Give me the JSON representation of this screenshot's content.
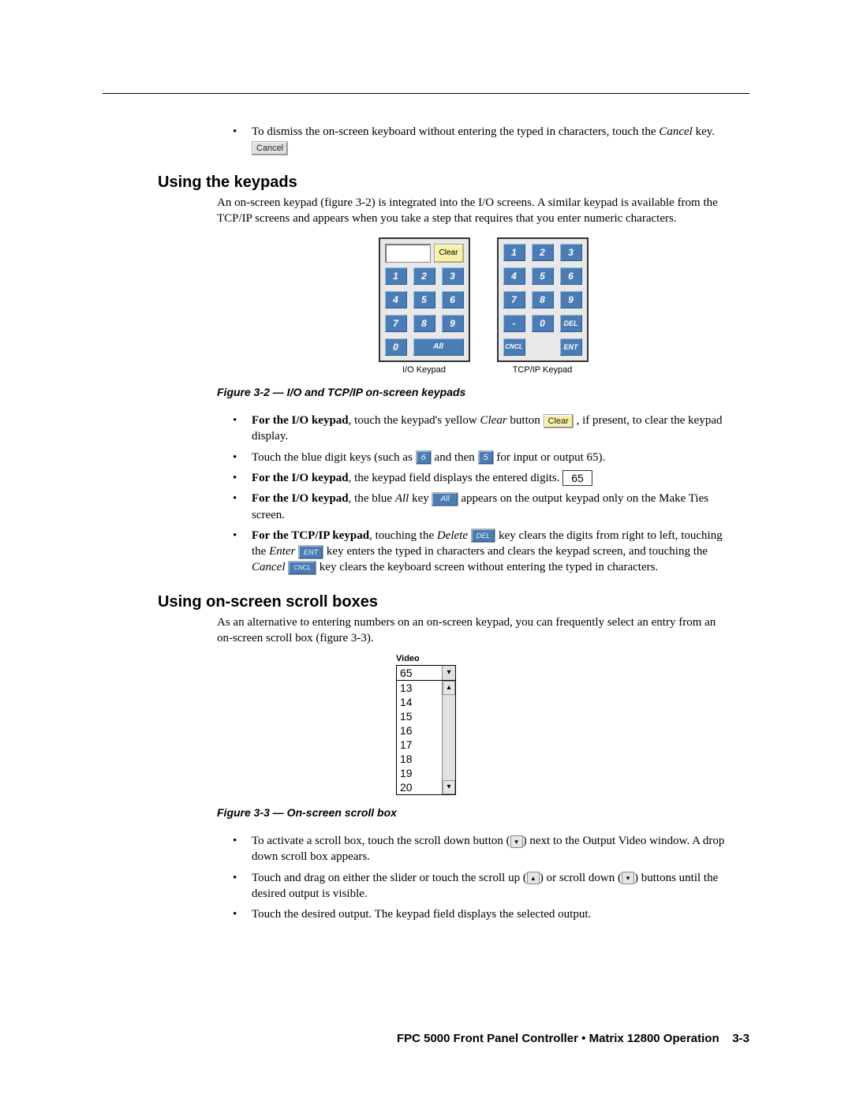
{
  "top": {
    "bullet1a": "To dismiss the on-screen keyboard without entering the typed in characters, touch the ",
    "bullet1b": "Cancel",
    "bullet1c": " key.  ",
    "cancel_btn": "Cancel"
  },
  "sec1": {
    "heading": "Using the keypads",
    "para": "An on-screen keypad (figure 3-2) is integrated into the I/O screens.  A similar keypad is available from the TCP/IP screens and appears when you take a step that requires that you enter numeric characters."
  },
  "keypads": {
    "io": {
      "clear": "Clear",
      "keys": [
        "1",
        "2",
        "3",
        "4",
        "5",
        "6",
        "7",
        "8",
        "9",
        "0",
        "All"
      ],
      "label": "I/O Keypad"
    },
    "tcp": {
      "keys": [
        "1",
        "2",
        "3",
        "4",
        "5",
        "6",
        "7",
        "8",
        "9",
        "-",
        "0",
        "DEL",
        "CNCL",
        "ENT"
      ],
      "label": "TCP/IP Keypad"
    }
  },
  "caption1": "Figure 3-2 — I/O and TCP/IP on-screen keypads",
  "bullets2": {
    "b1a": "For the I/O keypad",
    "b1b": ", touch the keypad's yellow ",
    "b1c": "Clear",
    "b1d": " button  ",
    "b1btn": "Clear",
    "b1e": ", if present, to clear the keypad display.",
    "b2a": "Touch the blue digit keys (such as  ",
    "b2btn1": "6",
    "b2b": " and then  ",
    "b2btn2": "5",
    "b2c": " for input or output 65).",
    "b3a": "For the I/O keypad",
    "b3b": ", the keypad field displays the entered digits.   ",
    "b3field": "65",
    "b4a": "For the I/O keypad",
    "b4b": ", the blue ",
    "b4c": "All",
    "b4d": " key  ",
    "b4btn": "All",
    "b4e": "  appears on the output keypad only on the Make Ties screen.",
    "b5a": "For the TCP/IP keypad",
    "b5b": ", touching the ",
    "b5c": "Delete ",
    "b5btn1": "DEL",
    "b5d": " key clears the digits from right to left, touching the ",
    "b5e": "Enter ",
    "b5btn2": "ENT",
    "b5f": " key enters the typed in characters and clears the keypad screen, and touching the ",
    "b5g": "Cancel ",
    "b5btn3": "CNCL",
    "b5h": " key clears the keyboard screen without entering the typed in characters."
  },
  "sec2": {
    "heading": "Using on-screen scroll boxes",
    "para": "As an alternative to entering numbers on an on-screen keypad, you can frequently select an entry from an on-screen scroll box (figure 3-3)."
  },
  "scrollbox": {
    "title": "Video",
    "value": "65",
    "items": [
      "13",
      "14",
      "15",
      "16",
      "17",
      "18",
      "19",
      "20"
    ]
  },
  "caption2": "Figure 3-3 — On-screen scroll box",
  "bullets3": {
    "b1": "To activate a scroll box, touch the scroll down button (",
    "b1b": ") next to the Output Video window.  A drop down scroll box appears.",
    "b2": "Touch and drag on either the slider or touch the scroll up (",
    "b2b": ") or scroll down (",
    "b2c": ") buttons until the desired output is visible.",
    "b3": "Touch the desired output.  The keypad field displays the selected output."
  },
  "footer": {
    "text": "FPC 5000 Front Panel Controller • Matrix 12800 Operation",
    "page": "3-3"
  }
}
